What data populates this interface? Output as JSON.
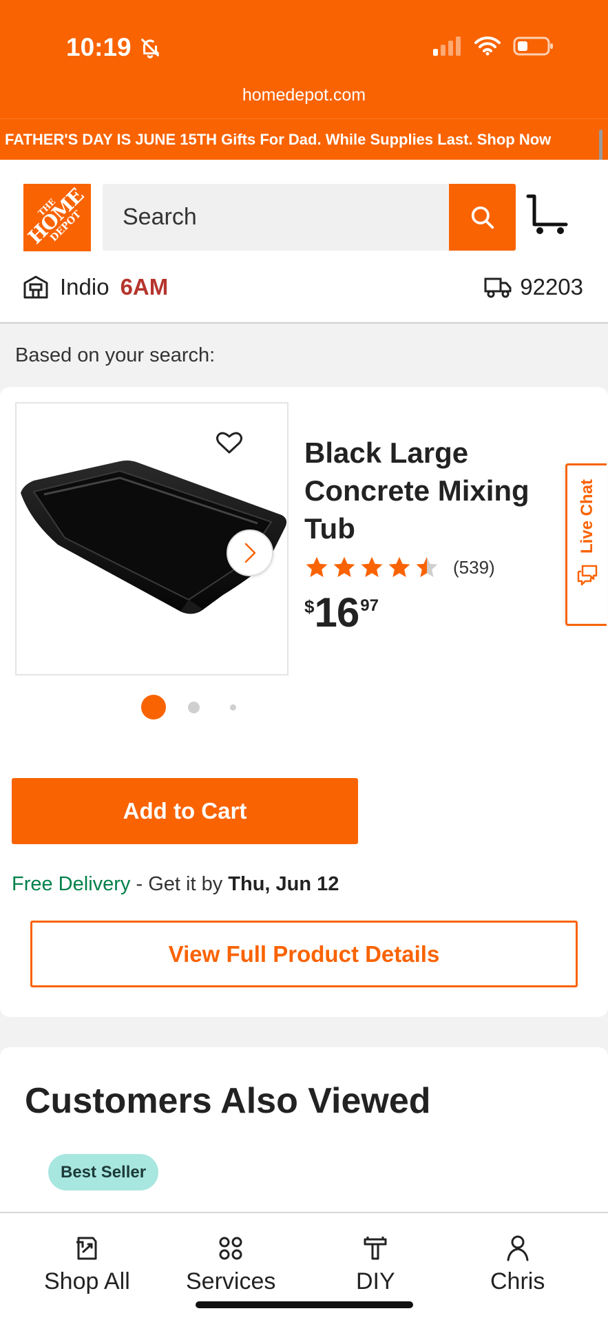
{
  "status_bar": {
    "time": "10:19"
  },
  "browser": {
    "url": "homedepot.com"
  },
  "promo": {
    "text": "FATHER'S DAY IS JUNE 15TH Gifts For Dad. While Supplies Last. Shop Now"
  },
  "header": {
    "logo": {
      "line1": "THE",
      "line2": "HOME",
      "line3": "DEPOT"
    },
    "search_placeholder": "Search",
    "store_name": "Indio",
    "store_hours": "6AM",
    "zip": "92203"
  },
  "section": {
    "based_on": "Based on your search:"
  },
  "product": {
    "title": "Black Large Concrete Mixing Tub",
    "rating": 4.5,
    "review_count": "(539)",
    "price_currency": "$",
    "price_dollars": "16",
    "price_cents": "97",
    "image_index": 1,
    "image_count": 3
  },
  "actions": {
    "add_to_cart": "Add to Cart",
    "view_details": "View Full Product Details",
    "live_chat": "Live Chat"
  },
  "delivery": {
    "label": "Free Delivery",
    "separator": " - Get it by ",
    "date": "Thu, Jun 12"
  },
  "also_viewed": {
    "title": "Customers Also Viewed",
    "badge": "Best Seller"
  },
  "bottom_nav": [
    {
      "label": "Shop All",
      "icon": "shop-all-icon"
    },
    {
      "label": "Services",
      "icon": "services-icon"
    },
    {
      "label": "DIY",
      "icon": "diy-icon"
    },
    {
      "label": "Chris",
      "icon": "account-icon"
    }
  ],
  "colors": {
    "brand": "#f96302",
    "free_delivery": "#00804a",
    "store_hours": "#b5352d",
    "badge": "#a8e6e0"
  }
}
